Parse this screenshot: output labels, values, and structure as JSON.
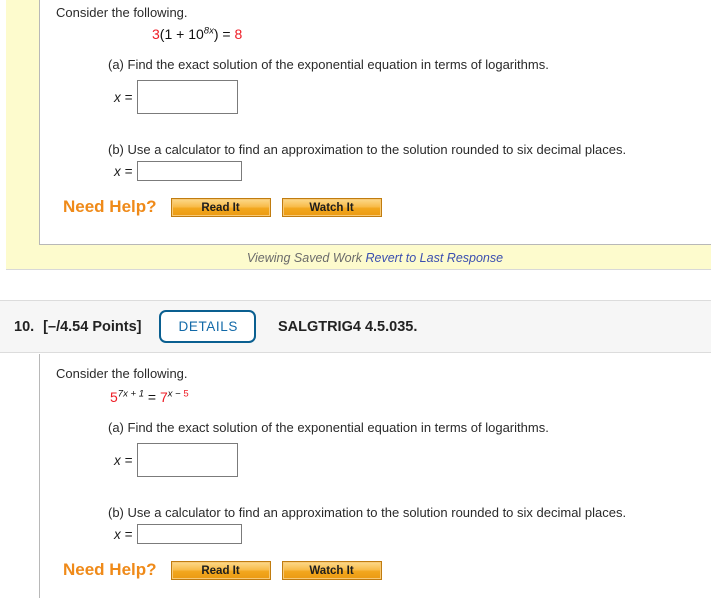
{
  "question9": {
    "consider_text": "Consider the following.",
    "equation": {
      "parts": [
        {
          "t": "3",
          "c": "red"
        },
        {
          "t": "(1 + 10",
          "c": "black"
        },
        {
          "t": "8x",
          "c": "black",
          "sup": true
        },
        {
          "t": ") = ",
          "c": "black"
        },
        {
          "t": "8",
          "c": "red"
        }
      ],
      "plain": "3(1 + 10^(8x)) = 8"
    },
    "part_a_text": "(a) Find the exact solution of the exponential equation in terms of logarithms.",
    "part_b_text": "(b) Use a calculator to find an approximation to the solution rounded to six decimal places.",
    "x_label": "x =",
    "answer_a_value": "",
    "answer_b_value": "",
    "need_help_label": "Need Help?",
    "read_it_label": "Read It",
    "watch_it_label": "Watch It",
    "saved_work_label": "Viewing Saved Work",
    "revert_link_label": "Revert to Last Response"
  },
  "question10": {
    "number": "10.",
    "points": "[–/4.54 Points]",
    "details_label": "DETAILS",
    "code": "SALGTRIG4 4.5.035.",
    "consider_text": "Consider the following.",
    "equation": {
      "parts": [
        {
          "t": "5",
          "c": "red"
        },
        {
          "t": "7x + 1",
          "c": "black",
          "sup": true
        },
        {
          "t": " = ",
          "c": "black"
        },
        {
          "t": "7",
          "c": "red"
        },
        {
          "t": "x − ",
          "c": "black",
          "sup": true
        },
        {
          "t": "5",
          "c": "red",
          "sup": true
        }
      ],
      "plain": "5^(7x + 1) = 7^(x − 5)"
    },
    "part_a_text": "(a) Find the exact solution of the exponential equation in terms of logarithms.",
    "part_b_text": "(b) Use a calculator to find an approximation to the solution rounded to six decimal places.",
    "x_label": "x =",
    "answer_a_value": "",
    "answer_b_value": "",
    "need_help_label": "Need Help?",
    "read_it_label": "Read It",
    "watch_it_label": "Watch It"
  },
  "colors": {
    "equation_red": "#ee1c25",
    "need_help_orange": "#ef8a19",
    "details_blue": "#1269a8",
    "saved_work_yellow": "#fdfbcd",
    "link_blue": "#3b4fb0"
  }
}
